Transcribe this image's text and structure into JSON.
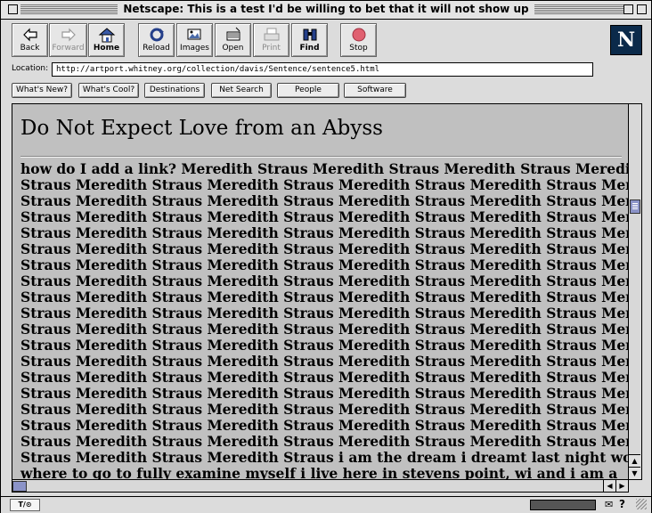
{
  "window": {
    "title": "Netscape: This is a test I'd be willing to bet that it will not show up"
  },
  "toolbar": {
    "buttons": [
      {
        "label": "Back",
        "icon": "back-arrow-icon"
      },
      {
        "label": "Forward",
        "icon": "forward-arrow-icon",
        "disabled": true
      },
      {
        "label": "Home",
        "icon": "home-icon"
      },
      {
        "label": "Reload",
        "icon": "reload-icon"
      },
      {
        "label": "Images",
        "icon": "images-icon"
      },
      {
        "label": "Open",
        "icon": "open-icon"
      },
      {
        "label": "Print",
        "icon": "print-icon",
        "disabled": true
      },
      {
        "label": "Find",
        "icon": "find-binoculars-icon"
      },
      {
        "label": "Stop",
        "icon": "stop-icon"
      }
    ],
    "logo": "N"
  },
  "location": {
    "label": "Location:",
    "url": "http://artport.whitney.org/collection/davis/Sentence/sentence5.html"
  },
  "directory": {
    "buttons": [
      "What's New?",
      "What's Cool?",
      "Destinations",
      "Net Search",
      "People",
      "Software"
    ]
  },
  "page": {
    "heading": "Do Not Expect Love from an Abyss",
    "lines": [
      "how do I add a link? Meredith Straus Meredith Straus Meredith Straus Meredith",
      "Straus Meredith Straus Meredith Straus Meredith Straus Meredith Straus Meredith",
      "Straus Meredith Straus Meredith Straus Meredith Straus Meredith Straus Meredith",
      "Straus Meredith Straus Meredith Straus Meredith Straus Meredith Straus Meredith",
      "Straus Meredith Straus Meredith Straus Meredith Straus Meredith Straus Meredith",
      "Straus Meredith Straus Meredith Straus Meredith Straus Meredith Straus Meredith",
      "Straus Meredith Straus Meredith Straus Meredith Straus Meredith Straus Meredith",
      "Straus Meredith Straus Meredith Straus Meredith Straus Meredith Straus Meredith",
      "Straus Meredith Straus Meredith Straus Meredith Straus Meredith Straus Meredith",
      "Straus Meredith Straus Meredith Straus Meredith Straus Meredith Straus Meredith",
      "Straus Meredith Straus Meredith Straus Meredith Straus Meredith Straus Meredith",
      "Straus Meredith Straus Meredith Straus Meredith Straus Meredith Straus Meredith",
      "Straus Meredith Straus Meredith Straus Meredith Straus Meredith Straus Meredith",
      "Straus Meredith Straus Meredith Straus Meredith Straus Meredith Straus Meredith",
      "Straus Meredith Straus Meredith Straus Meredith Straus Meredith Straus Meredith",
      "Straus Meredith Straus Meredith Straus Meredith Straus Meredith Straus Meredith",
      "Straus Meredith Straus Meredith Straus Meredith Straus Meredith Straus Meredith",
      "Straus Meredith Straus Meredith Straus Meredith Straus Meredith Straus Meredith",
      "Straus Meredith Straus Meredith Straus i am the dream i dreamt last night wondering",
      "where to go to fully examine myself i live here in stevens point, wi and i am a"
    ]
  },
  "statusbar": {
    "security": "T/⊙",
    "text": ""
  }
}
